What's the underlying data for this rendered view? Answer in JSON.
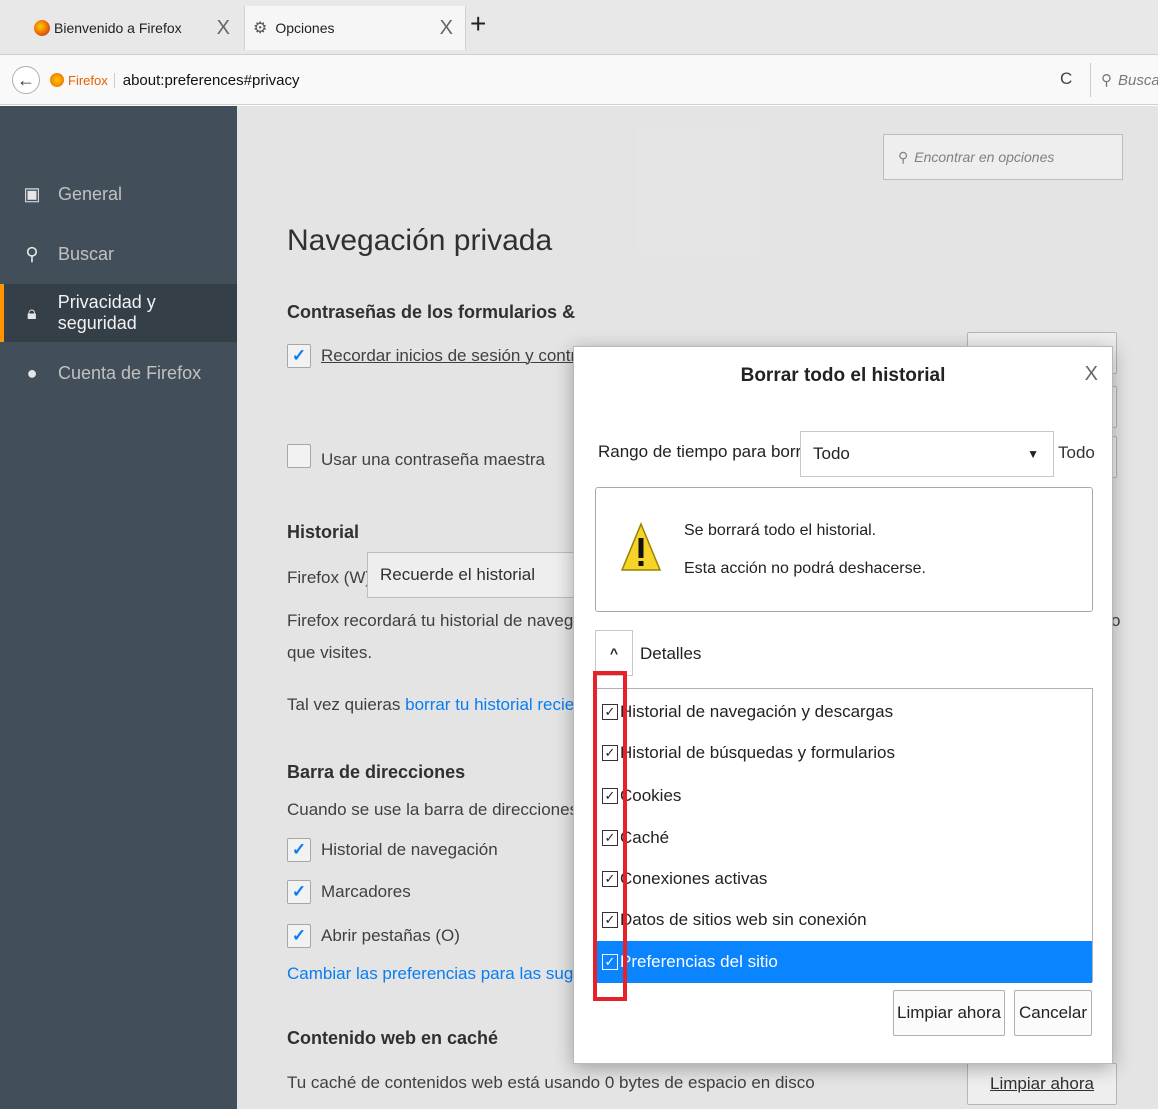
{
  "tabs": [
    {
      "label": "Bienvenido a Firefox",
      "close": "X"
    },
    {
      "label": "Opciones",
      "close": "X"
    }
  ],
  "newtab_glyph": "+",
  "navbar": {
    "brand": "Firefox",
    "url": "about:preferences#privacy",
    "search_placeholder": "Busca"
  },
  "sidebar": {
    "items": [
      {
        "label": "General",
        "icon": "general-icon"
      },
      {
        "label": "Buscar",
        "icon": "search-icon"
      },
      {
        "label": "Privacidad y seguridad",
        "icon": "lock-icon",
        "active": true
      },
      {
        "label": "Cuenta de Firefox",
        "icon": "account-icon"
      }
    ]
  },
  "content": {
    "find_placeholder": "Encontrar en opciones",
    "title": "Navegación privada",
    "passwords_heading": "Contraseñas de los formularios &",
    "remember_logins": "Recordar inicios de sesión y contrase",
    "master_password": "Usar una contraseña maestra",
    "history_heading": "Historial",
    "firefox_label": "Firefox (W)",
    "history_select": "Recuerde el historial",
    "history_desc_1": "Firefox recordará tu historial de navegació",
    "history_desc_2": "que visites.",
    "clear_hint_prefix": "Tal vez quieras ",
    "clear_hint_link": "borrar tu historial reciente,",
    "addressbar_heading": "Barra de direcciones",
    "addressbar_desc": "Cuando se use la barra de direcciones, sug",
    "addr_history": "Historial de navegación",
    "addr_bookmarks": "Marcadores",
    "addr_tabs": "Abrir pestañas (O)",
    "change_prefs_link": "Cambiar las preferencias para las sugeren",
    "cache_heading": "Contenido web en caché",
    "cache_desc": "Tu caché de contenidos web está usando 0 bytes de espacio en disco",
    "clear_now_btn": "Limpiar ahora",
    "right_edge_o": "o"
  },
  "dialog": {
    "title": "Borrar todo el historial",
    "close": "X",
    "range_label": "Rango de tiempo para borrar:",
    "range_value": "Todo",
    "range_extra": "Todo",
    "warning_line1": "Se borrará todo el historial.",
    "warning_line2": "Esta acción no podrá deshacerse.",
    "details_label": "Detalles",
    "items": [
      {
        "label": "Historial de navegación y descargas",
        "checked": true
      },
      {
        "label": "Historial de búsquedas y formularios",
        "checked": true
      },
      {
        "label": "Cookies",
        "checked": true
      },
      {
        "label": "Caché",
        "checked": true
      },
      {
        "label": "Conexiones activas",
        "checked": true
      },
      {
        "label": "Datos de sitios web sin conexión",
        "checked": true
      },
      {
        "label": "Preferencias del sitio",
        "checked": true,
        "selected": true
      }
    ],
    "clear_button": "Limpiar ahora",
    "cancel_button": "Cancelar"
  },
  "colors": {
    "sidebar_bg": "#424f5a",
    "accent": "#0a84ff",
    "active_indicator": "#ff9500",
    "highlight_annotation": "#e8202a"
  }
}
